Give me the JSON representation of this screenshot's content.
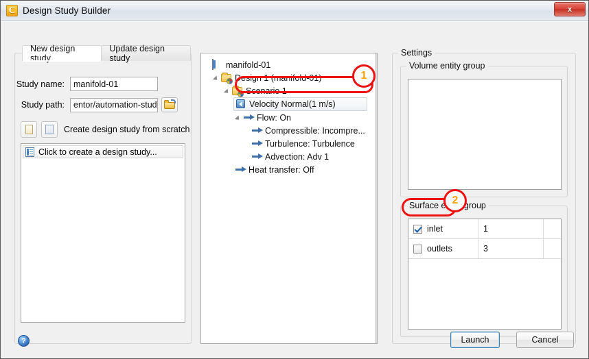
{
  "window": {
    "title": "Design Study Builder",
    "app_icon": "cfd-app-icon",
    "close_label": "x"
  },
  "left_panel": {
    "tabs": [
      {
        "label": "New design study",
        "active": true
      },
      {
        "label": "Update design study",
        "active": false
      }
    ],
    "fields": [
      {
        "label": "Study name:",
        "value": "manifold-01",
        "placeholder": ""
      },
      {
        "label": "Study path:",
        "value": "entor/automation-study",
        "placeholder": ""
      }
    ],
    "browse_icon": "open-folder-icon",
    "scratch_row": {
      "new_doc_icon": "new-document-icon",
      "blank_doc_icon": "blank-document-icon",
      "label": "Create design study from scratch"
    },
    "study_list": [
      {
        "icon": "design-study-icon",
        "label": "Click to create a design study..."
      }
    ]
  },
  "tree": {
    "nodes": [
      {
        "label": "manifold-01",
        "indent": 0,
        "icon": "document-list-icon",
        "twisty": "none",
        "selected": false
      },
      {
        "label": "Design 1 (manifold-01)",
        "indent": 1,
        "icon": "design-folder-icon",
        "twisty": "open",
        "selected": false
      },
      {
        "label": "Scenario 1",
        "indent": 2,
        "icon": "scenario-folder-icon",
        "twisty": "open",
        "selected": false
      },
      {
        "label": "Velocity Normal(1 m/s)",
        "indent": 3,
        "icon": "velocity-icon",
        "twisty": "none",
        "selected": true
      },
      {
        "label": "Flow: On",
        "indent": 3,
        "icon": "arrow-icon",
        "twisty": "open",
        "selected": false
      },
      {
        "label": "Compressible: Incompre...",
        "indent": 4,
        "icon": "arrow-icon",
        "twisty": "none",
        "selected": false
      },
      {
        "label": "Turbulence: Turbulence",
        "indent": 4,
        "icon": "arrow-icon",
        "twisty": "none",
        "selected": false
      },
      {
        "label": "Advection: Adv 1",
        "indent": 4,
        "icon": "arrow-icon",
        "twisty": "none",
        "selected": false
      },
      {
        "label": "Heat transfer: Off",
        "indent": 3,
        "icon": "arrow-icon",
        "twisty": "none",
        "selected": false
      }
    ]
  },
  "settings": {
    "legend": "Settings",
    "volume_group": {
      "legend": "Volume entity group",
      "rows": []
    },
    "surface_group": {
      "legend": "Surface entity group",
      "rows": [
        {
          "name": "inlet",
          "count": "1",
          "checked": true
        },
        {
          "name": "outlets",
          "count": "3",
          "checked": false
        }
      ]
    }
  },
  "footer": {
    "help_icon": "help-icon",
    "help_glyph": "?",
    "launch_label": "Launch",
    "cancel_label": "Cancel"
  },
  "annotations": [
    {
      "number": "1",
      "target": "velocity-normal-node"
    },
    {
      "number": "2",
      "target": "inlet-checkbox-row"
    }
  ],
  "colors": {
    "accent_red": "#ee1111",
    "anno_number": "#f5a200",
    "dialog_bg": "#f0f0f0",
    "panel_bg": "#ffffff",
    "default_button_border": "#3c7fb1"
  }
}
